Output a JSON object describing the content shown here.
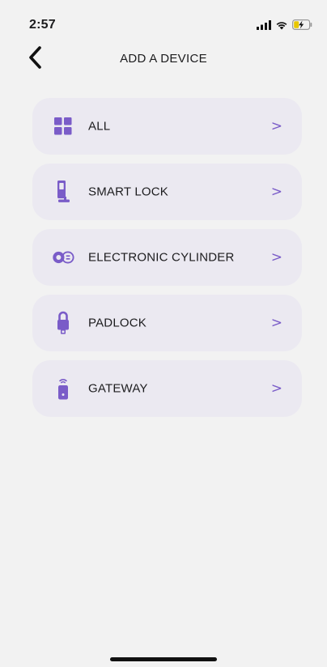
{
  "status_bar": {
    "time": "2:57"
  },
  "header": {
    "title": "ADD A DEVICE",
    "back_icon": "chevron-left-icon"
  },
  "accent_color": "#7a5cc8",
  "devices": [
    {
      "label": "ALL",
      "icon": "grid-icon",
      "chevron": ">"
    },
    {
      "label": "SMART LOCK",
      "icon": "smart-lock-icon",
      "chevron": ">"
    },
    {
      "label": "ELECTRONIC CYLINDER",
      "icon": "cylinder-icon",
      "chevron": ">"
    },
    {
      "label": "PADLOCK",
      "icon": "padlock-icon",
      "chevron": ">"
    },
    {
      "label": "GATEWAY",
      "icon": "gateway-icon",
      "chevron": ">"
    }
  ]
}
